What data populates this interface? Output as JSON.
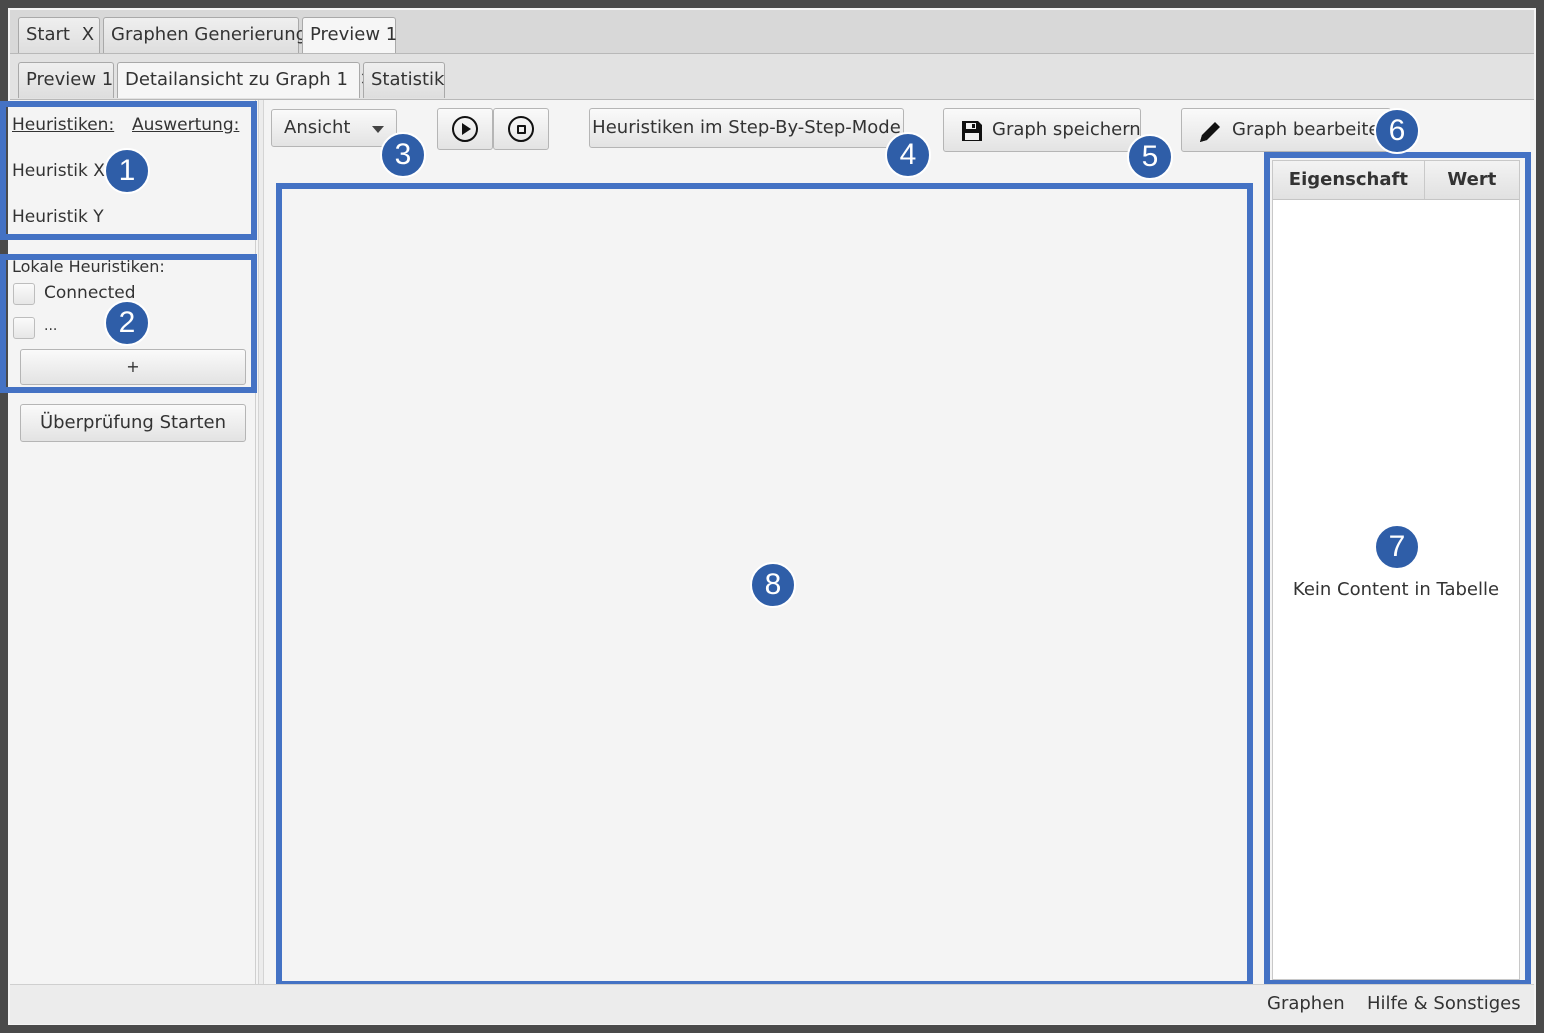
{
  "tabs_level1": [
    {
      "label": "Start",
      "close": "X"
    },
    {
      "label": "Graphen Generierung"
    },
    {
      "label": "Preview 1"
    }
  ],
  "tabs_level2": [
    {
      "label": "Preview 1"
    },
    {
      "label": "Detailansicht zu Graph 1",
      "close": "✕"
    },
    {
      "label": "Statistik"
    }
  ],
  "left_panel": {
    "heuristics_label": "Heuristiken:",
    "evaluation_label": "Auswertung:",
    "heuristics": [
      "Heuristik X",
      "Heuristik Y"
    ],
    "local_label": "Lokale Heuristiken:",
    "local_items": [
      {
        "label": "Connected",
        "checked": false
      },
      {
        "label": "...",
        "checked": false
      }
    ],
    "add_button": "+",
    "start_check_button": "Überprüfung Starten"
  },
  "toolbar": {
    "view_dropdown": "Ansicht",
    "play_icon": "play-icon",
    "stop_icon": "stop-icon",
    "step_mode_button": "Heuristiken im Step-By-Step-Mode",
    "save_button": "Graph speichern",
    "edit_button": "Graph bearbeiten"
  },
  "property_table": {
    "columns": [
      "Eigenschaft",
      "Wert"
    ],
    "empty_text": "Kein Content in Tabelle"
  },
  "annotations": [
    "1",
    "2",
    "3",
    "4",
    "5",
    "6",
    "7",
    "8"
  ],
  "status_bar": {
    "items": [
      "Graphen",
      "Hilfe & Sonstiges"
    ]
  },
  "colors": {
    "highlight": "#4472c4",
    "badge": "#2f5ea8"
  }
}
